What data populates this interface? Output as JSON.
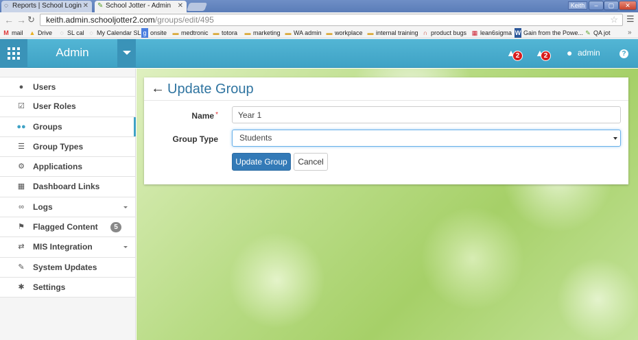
{
  "browser": {
    "tabs": [
      {
        "label": "Reports | School Login",
        "active": false
      },
      {
        "label": "School Jotter - Admin",
        "active": true
      }
    ],
    "profile_name": "Keith",
    "window_controls": {
      "minimize": "‒",
      "maximize": "▢",
      "close": "✕"
    },
    "url_host": "keith.admin.schooljotter2.com",
    "url_path": "/groups/edit/495",
    "bookmarks": [
      {
        "label": "mail",
        "icon": "gmail-icon"
      },
      {
        "label": "Drive",
        "icon": "drive-icon"
      },
      {
        "label": "SL cal",
        "icon": "calendar-icon"
      },
      {
        "label": "My Calendar SL",
        "icon": "calendar-icon"
      },
      {
        "label": "onsite",
        "icon": "google-icon"
      },
      {
        "label": "medtronic",
        "icon": "folder-icon"
      },
      {
        "label": "totora",
        "icon": "folder-icon"
      },
      {
        "label": "marketing",
        "icon": "folder-icon"
      },
      {
        "label": "WA admin",
        "icon": "folder-icon"
      },
      {
        "label": "workplace",
        "icon": "folder-icon"
      },
      {
        "label": "internal training",
        "icon": "folder-icon"
      },
      {
        "label": "product bugs",
        "icon": "bug-icon"
      },
      {
        "label": "lean6sigma",
        "icon": "grid-icon"
      },
      {
        "label": "Gain from the Powe...",
        "icon": "word-icon"
      },
      {
        "label": "QA jot",
        "icon": "leaf-icon"
      }
    ],
    "bookmarks_overflow": "»"
  },
  "header": {
    "brand": "Admin",
    "notifications_count": "2",
    "alerts_count": "2",
    "user_name": "admin",
    "help_glyph": "?"
  },
  "sidebar": {
    "items": [
      {
        "label": "Users",
        "icon": "user-icon",
        "active": false
      },
      {
        "label": "User Roles",
        "icon": "checkbox-icon",
        "active": false
      },
      {
        "label": "Groups",
        "icon": "group-icon",
        "active": true
      },
      {
        "label": "Group Types",
        "icon": "list-icon",
        "active": false
      },
      {
        "label": "Applications",
        "icon": "applications-icon",
        "active": false
      },
      {
        "label": "Dashboard Links",
        "icon": "grid-icon",
        "active": false
      },
      {
        "label": "Logs",
        "icon": "binoculars-icon",
        "active": false,
        "has_submenu": true
      },
      {
        "label": "Flagged Content",
        "icon": "flag-icon",
        "active": false,
        "badge": "5"
      },
      {
        "label": "MIS Integration",
        "icon": "exchange-icon",
        "active": false,
        "has_submenu": true
      },
      {
        "label": "System Updates",
        "icon": "wrench-icon",
        "active": false
      },
      {
        "label": "Settings",
        "icon": "gear-icon",
        "active": false
      }
    ]
  },
  "form": {
    "title": "Update Group",
    "name_label": "Name",
    "required_marker": "*",
    "name_value": "Year 1",
    "group_type_label": "Group Type",
    "group_type_value": "Students",
    "submit_label": "Update Group",
    "cancel_label": "Cancel"
  },
  "colors": {
    "accent": "#3fa2c5",
    "primary_button": "#337ab7",
    "title": "#2f74a0",
    "badge_red": "#d81c1c"
  }
}
